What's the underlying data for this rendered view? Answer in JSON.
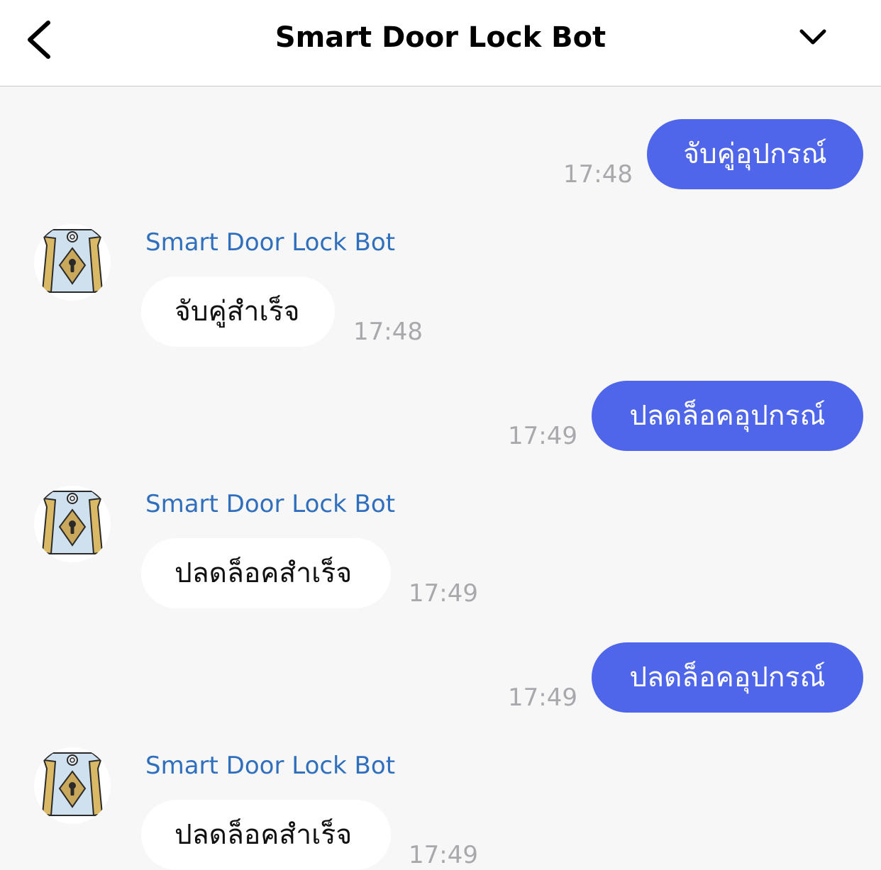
{
  "header": {
    "title": "Smart Door Lock Bot",
    "back_icon": "chevron-left-icon",
    "menu_icon": "chevron-down-icon"
  },
  "colors": {
    "outgoing_bubble": "#4f66ea",
    "incoming_bubble": "#ffffff",
    "sender_name": "#2f6fbd",
    "timestamp": "#a8a8ad",
    "background": "#f7f7f8"
  },
  "bot": {
    "name": "Smart Door Lock Bot",
    "avatar_icon": "door-lock-icon"
  },
  "messages": [
    {
      "direction": "out",
      "text": "จับคู่อุปกรณ์",
      "time": "17:48"
    },
    {
      "direction": "in",
      "sender": "Smart Door Lock Bot",
      "text": "จับคู่สำเร็จ",
      "time": "17:48"
    },
    {
      "direction": "out",
      "text": "ปลดล็อคอุปกรณ์",
      "time": "17:49"
    },
    {
      "direction": "in",
      "sender": "Smart Door Lock Bot",
      "text": "ปลดล็อคสำเร็จ",
      "time": "17:49"
    },
    {
      "direction": "out",
      "text": "ปลดล็อคอุปกรณ์",
      "time": "17:49"
    },
    {
      "direction": "in",
      "sender": "Smart Door Lock Bot",
      "text": "ปลดล็อคสำเร็จ",
      "time": "17:49"
    }
  ]
}
